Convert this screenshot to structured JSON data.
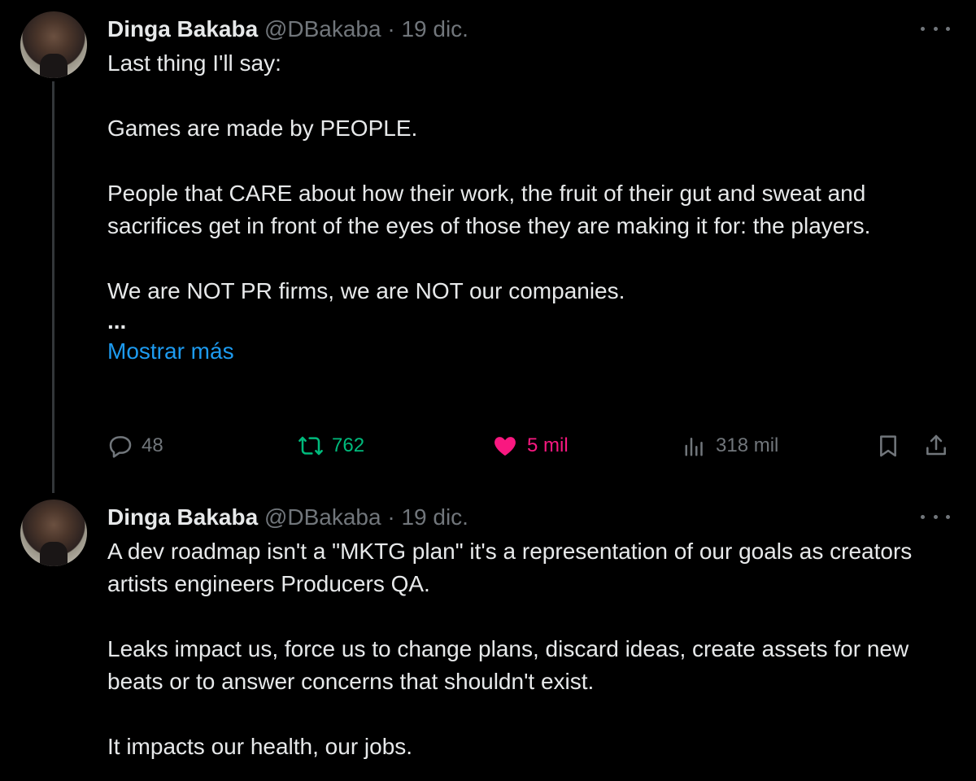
{
  "tweets": [
    {
      "author": {
        "name": "Dinga Bakaba",
        "handle": "@DBakaba",
        "date": "19 dic."
      },
      "separator": "·",
      "paragraphs": [
        "Last thing I'll say:",
        "Games are made by PEOPLE.",
        "People that CARE about how their work, the fruit of their gut and sweat and sacrifices get in front of the eyes of those they are making it for: the players.",
        "We are NOT PR firms, we are NOT our companies."
      ],
      "ellipsis": "...",
      "show_more": "Mostrar más",
      "stats": {
        "replies": "48",
        "retweets": "762",
        "likes": "5 mil",
        "views": "318 mil"
      }
    },
    {
      "author": {
        "name": "Dinga Bakaba",
        "handle": "@DBakaba",
        "date": "19 dic."
      },
      "separator": "·",
      "paragraphs": [
        "A dev roadmap isn't a \"MKTG plan\" it's a representation of our goals as creators artists engineers Producers QA.",
        "Leaks impact us, force us to change plans, discard ideas, create assets for new beats or to answer concerns that shouldn't exist.",
        "It impacts our health, our jobs."
      ]
    }
  ],
  "colors": {
    "background": "#000000",
    "text": "#e7e9ea",
    "muted": "#71767b",
    "link": "#1d9bf0",
    "retweet": "#00ba7c",
    "like": "#f91880"
  },
  "icons": [
    "more-icon",
    "reply-icon",
    "retweet-icon",
    "like-icon",
    "views-icon",
    "bookmark-icon",
    "share-icon"
  ]
}
